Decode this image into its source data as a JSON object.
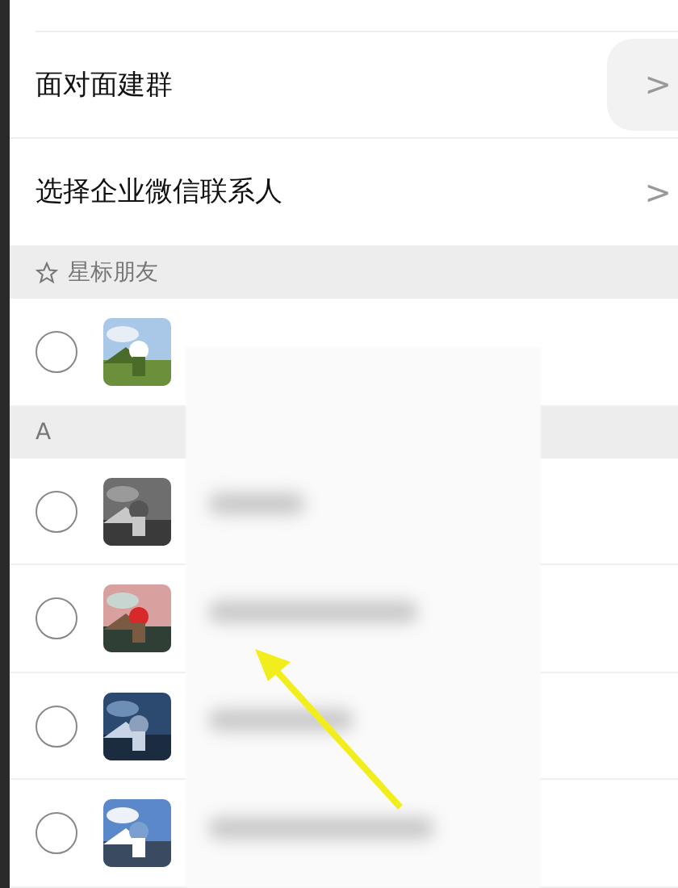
{
  "menu_items": [
    {
      "label": "面对面建群",
      "chevron": ">",
      "highlighted": true
    },
    {
      "label": "选择企业微信联系人",
      "chevron": ">",
      "highlighted": false
    }
  ],
  "sections": [
    {
      "header": "星标朋友",
      "starred": true,
      "contacts": [
        {
          "selected": false
        }
      ]
    },
    {
      "header": "A",
      "starred": false,
      "contacts": [
        {
          "selected": false
        },
        {
          "selected": false
        },
        {
          "selected": false
        },
        {
          "selected": false
        }
      ]
    }
  ]
}
